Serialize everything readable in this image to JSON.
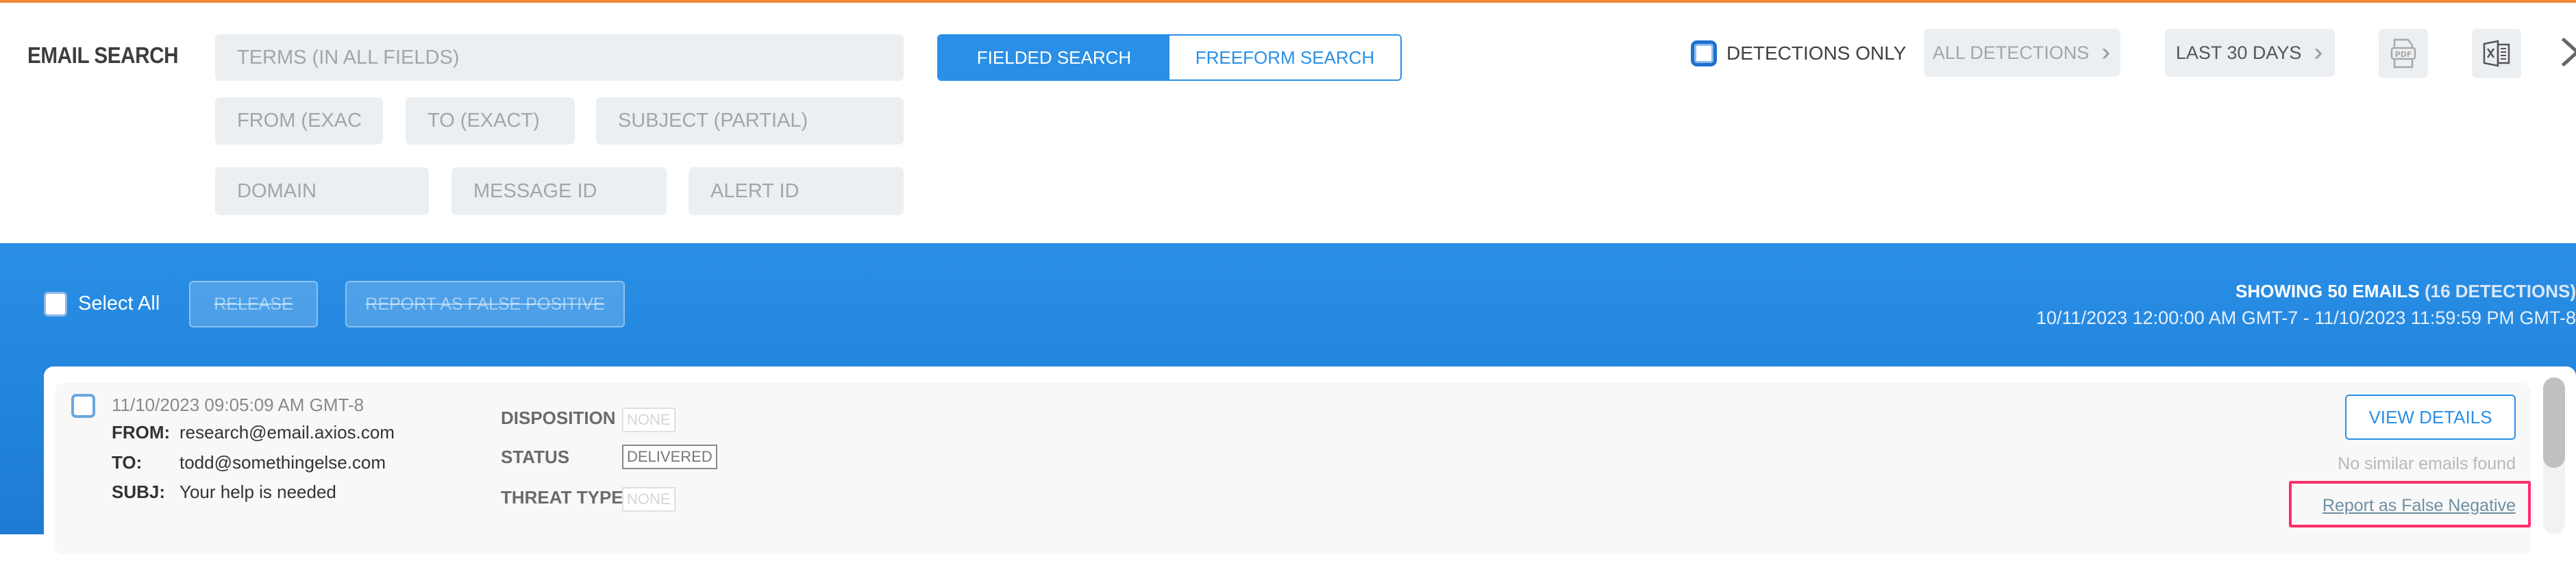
{
  "header": {
    "title": "EMAIL SEARCH",
    "accent_color": "#f0883a"
  },
  "search": {
    "terms_placeholder": "TERMS (IN ALL FIELDS)",
    "from_placeholder": "FROM (EXACT)",
    "to_placeholder": "TO (EXACT)",
    "subject_placeholder": "SUBJECT (PARTIAL)",
    "domain_placeholder": "DOMAIN",
    "message_id_placeholder": "MESSAGE ID",
    "alert_id_placeholder": "ALERT ID",
    "mode_tabs": [
      {
        "label": "FIELDED SEARCH",
        "active": true
      },
      {
        "label": "FREEFORM SEARCH",
        "active": false
      }
    ]
  },
  "filters": {
    "detections_only_label": "DETECTIONS ONLY",
    "detections_only_checked": false,
    "detection_type_selected": "ALL DETECTIONS",
    "time_range_selected": "LAST 30 DAYS",
    "export_pdf_icon": "pdf-file-icon",
    "export_excel_icon": "excel-file-icon",
    "close_icon": "close-icon"
  },
  "results_bar": {
    "select_all_label": "Select All",
    "release_label": "RELEASE",
    "report_false_positive_label": "REPORT AS FALSE POSITIVE",
    "summary_main": "SHOWING 50 EMAILS",
    "summary_detections": "(16 DETECTIONS)",
    "date_range": "10/11/2023 12:00:00 AM GMT-7 - 11/10/2023 11:59:59 PM GMT-8",
    "brand_color": "#2a8fe6"
  },
  "emails": [
    {
      "timestamp": "11/10/2023 09:05:09 AM GMT-8",
      "from_label": "FROM:",
      "from": "research@email.axios.com",
      "to_label": "TO:",
      "to": "todd@somethingelse.com",
      "subj_label": "SUBJ:",
      "subject": "Your help is needed",
      "disposition_label": "DISPOSITION",
      "disposition": "NONE",
      "status_label": "STATUS",
      "status": "DELIVERED",
      "threat_type_label": "THREAT TYPE",
      "threat_type": "NONE",
      "view_details_label": "VIEW DETAILS",
      "similar_text": "No similar emails found",
      "report_false_negative_label": "Report as False Negative",
      "highlight_color": "#ff2d6b"
    }
  ]
}
